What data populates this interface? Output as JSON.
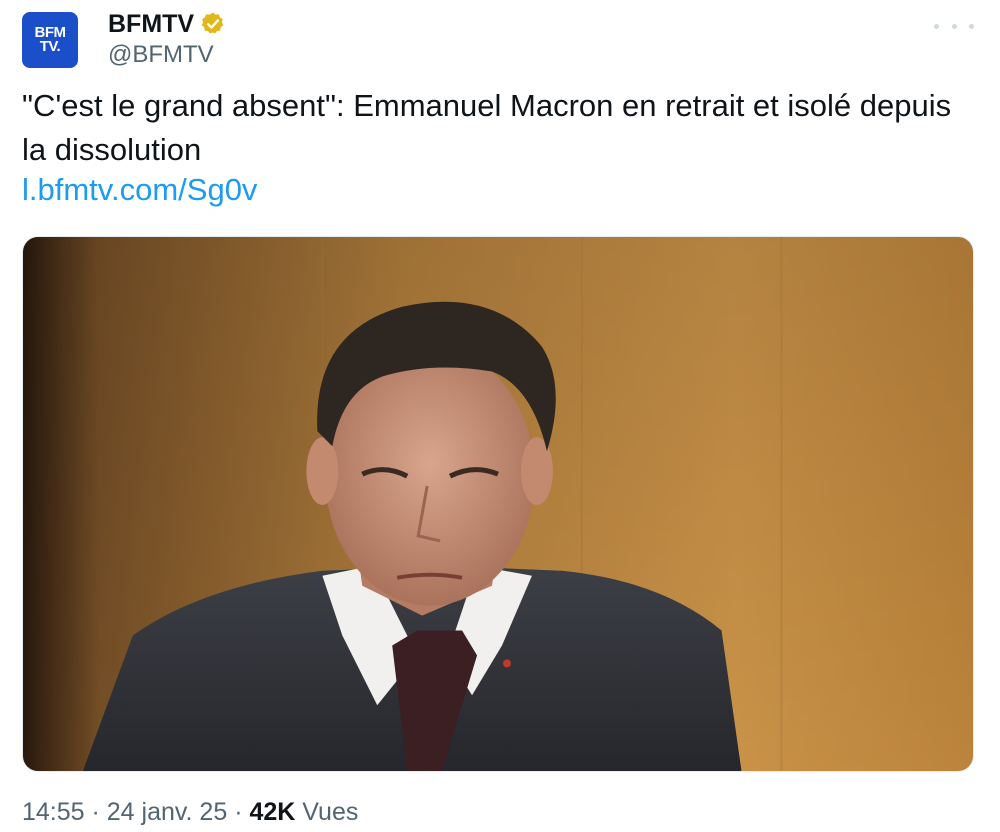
{
  "account": {
    "avatar_line1": "BFM",
    "avatar_line2": "TV.",
    "display_name": "BFMTV",
    "handle": "@BFMTV",
    "verified_color": "#e2b719"
  },
  "tweet": {
    "text": "\"C'est le grand absent\": Emmanuel Macron en retrait et isolé depuis la dissolution",
    "link": "l.bfmtv.com/Sg0v"
  },
  "media": {
    "icon": "photo"
  },
  "meta": {
    "time": "14:55",
    "separator1": " · ",
    "date": "24 janv. 25",
    "separator2": " · ",
    "views_count": "42K",
    "views_label": " Vues"
  },
  "colors": {
    "link": "#1d9bf0",
    "secondary_text": "#536471",
    "brand_blue": "#1b4fc9"
  }
}
